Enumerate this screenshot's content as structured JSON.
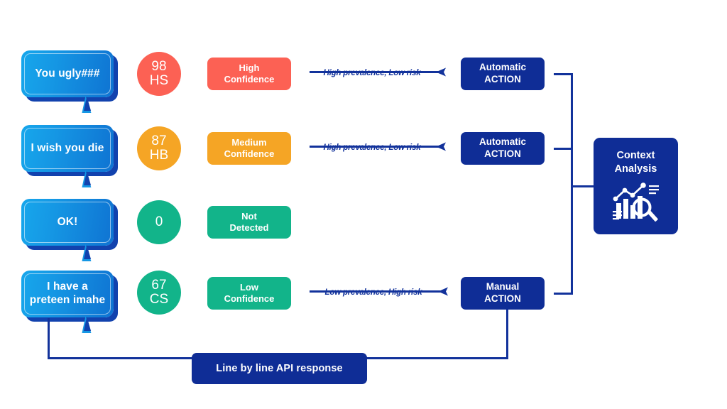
{
  "colors": {
    "navy": "#0F2D96",
    "line_navy": "#12329B",
    "coral": "#FC6154",
    "orange": "#F5A525",
    "green": "#12B48A",
    "bubble_light": "#17A7EC",
    "bubble_dark": "#0F73D2",
    "bubble_shadow": "#1242AE",
    "white": "#FFFFFF"
  },
  "rows": [
    {
      "message": "You ugly###",
      "score": "98",
      "code": "HS",
      "circle_color": "#FC6154",
      "confidence_label": "High\nConfidence",
      "confidence_line1": "High",
      "confidence_line2": "Confidence",
      "confidence_color": "#FC6154",
      "arrow_label": "High prevalence, Low risk",
      "action_line1": "Automatic",
      "action_line2": "ACTION",
      "has_arrow": true,
      "has_action": true
    },
    {
      "message": "I wish you die",
      "score": "87",
      "code": "HB",
      "circle_color": "#F5A525",
      "confidence_label": "Medium\nConfidence",
      "confidence_line1": "Medium",
      "confidence_line2": "Confidence",
      "confidence_color": "#F5A525",
      "arrow_label": "High prevalence, Low risk",
      "action_line1": "Automatic",
      "action_line2": "ACTION",
      "has_arrow": true,
      "has_action": true
    },
    {
      "message": "OK!",
      "score": "0",
      "code": "",
      "circle_color": "#12B48A",
      "confidence_label": "Not\nDetected",
      "confidence_line1": "Not",
      "confidence_line2": "Detected",
      "confidence_color": "#12B48A",
      "arrow_label": "",
      "action_line1": "",
      "action_line2": "",
      "has_arrow": false,
      "has_action": false
    },
    {
      "message": "I have a\npreteen imahe",
      "message_line1": "I have a",
      "message_line2": "preteen imahe",
      "score": "67",
      "code": "CS",
      "circle_color": "#12B48A",
      "confidence_label": "Low\nConfidence",
      "confidence_line1": "Low",
      "confidence_line2": "Confidence",
      "confidence_color": "#12B48A",
      "arrow_label": "Low prevalence, High risk",
      "action_line1": "Manual",
      "action_line2": "ACTION",
      "has_arrow": true,
      "has_action": true
    }
  ],
  "context": {
    "title_line1": "Context",
    "title_line2": "Analysis",
    "icon": "analytics-chart-magnifier-icon"
  },
  "footer": {
    "label": "Line by line API response"
  }
}
